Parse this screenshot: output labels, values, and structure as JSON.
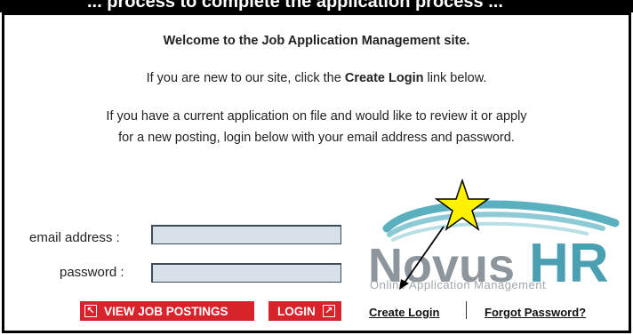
{
  "header": {
    "overflow_text": "... process to complete the application process ..."
  },
  "intro": {
    "welcome": "Welcome to the Job Application Management site.",
    "new_prefix": "If you are new to our site, click the ",
    "new_bold": "Create Login",
    "new_suffix": " link below.",
    "para_line1": "If you have a current application on file and would like to review it or apply",
    "para_line2": "for a new posting, login below with your email address and password."
  },
  "form": {
    "email_label": "email address :",
    "email_value": "",
    "password_label": "password :",
    "password_value": ""
  },
  "buttons": {
    "view_jobs": "VIEW JOB POSTINGS",
    "view_icon": "arrow-up-left-icon",
    "login": "LOGIN",
    "login_icon": "arrow-up-right-icon"
  },
  "links": {
    "create_login": "Create Login",
    "forgot_password": "Forgot Password?"
  },
  "logo": {
    "brand_part1": "Novus",
    "brand_part2": "HR",
    "tagline": "Online Application Management",
    "colors": {
      "novus": "#8d969d",
      "hr": "#4a9fb2",
      "swoosh": "#5bb0c0"
    }
  },
  "annotation": {
    "star_color": "#fff200",
    "arrow_target": "Create Login"
  }
}
